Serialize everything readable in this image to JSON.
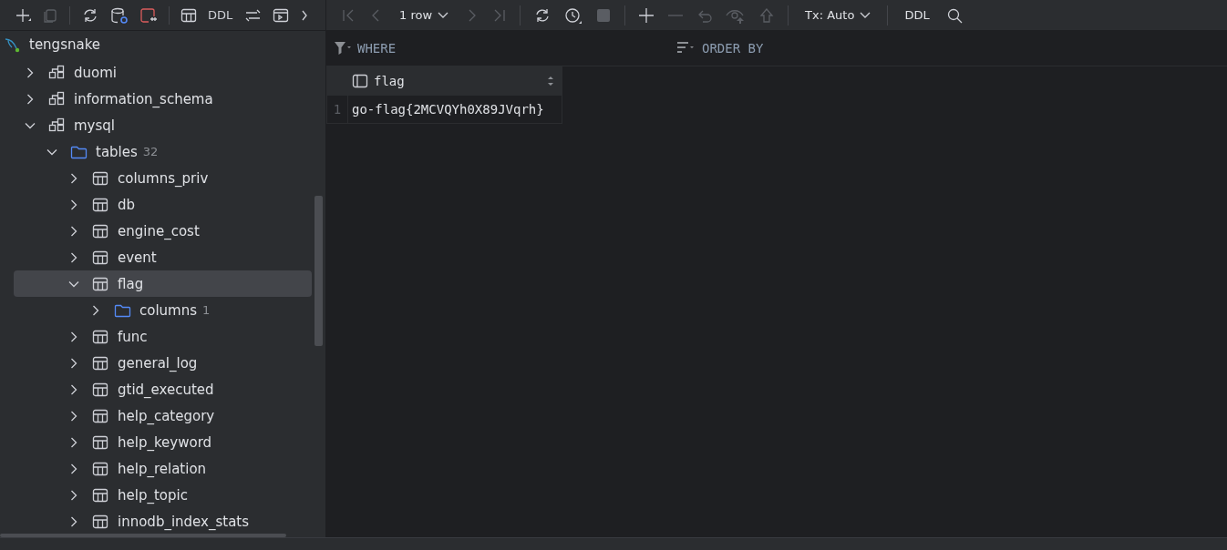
{
  "toolbar": {
    "ddl_label": "DDL"
  },
  "grid_toolbar": {
    "page_size": "1 row",
    "tx_mode": "Tx: Auto",
    "ddl_label": "DDL"
  },
  "tree": [
    {
      "label": "tengsnake",
      "kind": "connection",
      "children": [
        {
          "label": "duomi",
          "kind": "schema",
          "expanded": false,
          "selected": false
        },
        {
          "label": "information_schema",
          "kind": "schema",
          "expanded": false,
          "selected": false
        },
        {
          "label": "mysql",
          "kind": "schema",
          "expanded": true,
          "selected": false,
          "children": [
            {
              "label": "tables",
              "count": "32",
              "kind": "folder",
              "expanded": true,
              "selected": false,
              "children": [
                {
                  "label": "columns_priv",
                  "kind": "table",
                  "expanded": false,
                  "selected": false
                },
                {
                  "label": "db",
                  "kind": "table",
                  "expanded": false,
                  "selected": false
                },
                {
                  "label": "engine_cost",
                  "kind": "table",
                  "expanded": false,
                  "selected": false
                },
                {
                  "label": "event",
                  "kind": "table",
                  "expanded": false,
                  "selected": false
                },
                {
                  "label": "flag",
                  "kind": "table",
                  "expanded": true,
                  "selected": true,
                  "children": [
                    {
                      "label": "columns",
                      "count": "1",
                      "kind": "folder",
                      "expanded": false,
                      "selected": false
                    }
                  ]
                },
                {
                  "label": "func",
                  "kind": "table",
                  "expanded": false,
                  "selected": false
                },
                {
                  "label": "general_log",
                  "kind": "table",
                  "expanded": false,
                  "selected": false
                },
                {
                  "label": "gtid_executed",
                  "kind": "table",
                  "expanded": false,
                  "selected": false
                },
                {
                  "label": "help_category",
                  "kind": "table",
                  "expanded": false,
                  "selected": false
                },
                {
                  "label": "help_keyword",
                  "kind": "table",
                  "expanded": false,
                  "selected": false
                },
                {
                  "label": "help_relation",
                  "kind": "table",
                  "expanded": false,
                  "selected": false
                },
                {
                  "label": "help_topic",
                  "kind": "table",
                  "expanded": false,
                  "selected": false
                },
                {
                  "label": "innodb_index_stats",
                  "kind": "table",
                  "expanded": false,
                  "selected": false
                }
              ]
            }
          ]
        }
      ]
    }
  ],
  "filters": {
    "where": "WHERE",
    "order_by": "ORDER BY"
  },
  "grid": {
    "columns": [
      {
        "name": "flag"
      }
    ],
    "rows": [
      {
        "number": "1",
        "cells": [
          "go-flag{2MCVQYh0X89JVqrh}"
        ]
      }
    ]
  }
}
